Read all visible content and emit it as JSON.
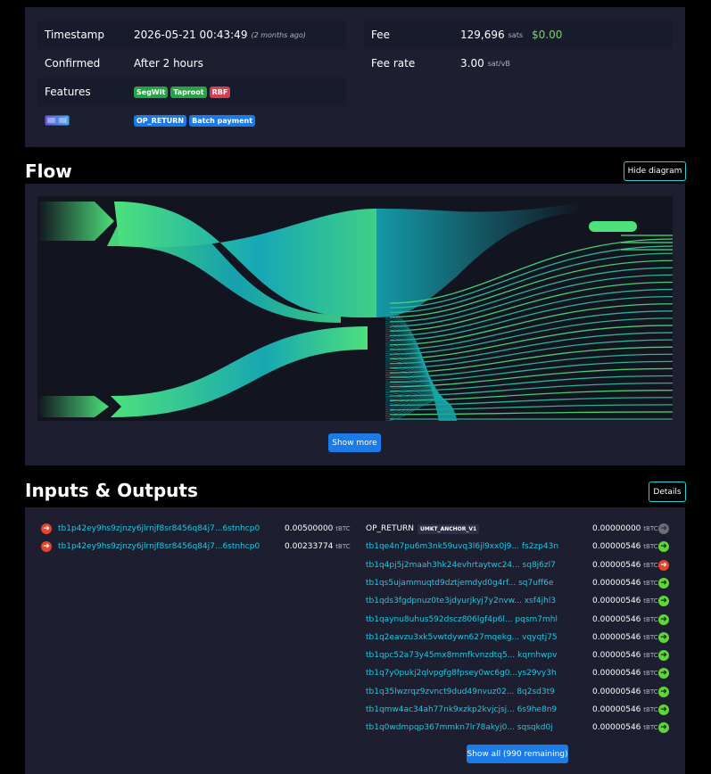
{
  "details": {
    "timestamp_label": "Timestamp",
    "timestamp_value": "2026-05-21 00:43:49",
    "timestamp_ago": "(2 months ago)",
    "confirmed_label": "Confirmed",
    "confirmed_value": "After 2 hours",
    "features_label": "Features",
    "features": [
      "SegWit",
      "Taproot",
      "RBF"
    ],
    "features_row2": [
      "OP_RETURN",
      "Batch payment"
    ],
    "fee_label": "Fee",
    "fee_value": "129,696",
    "fee_unit": "sats",
    "fee_fiat": "$0.00",
    "feerate_label": "Fee rate",
    "feerate_value": "3.00",
    "feerate_unit": "sat/vB"
  },
  "flow": {
    "title": "Flow",
    "hide_button": "Hide diagram",
    "show_more_button": "Show more"
  },
  "io": {
    "title": "Inputs & Outputs",
    "details_button": "Details",
    "inputs": [
      {
        "address": "tb1p42ey9hs9zjnzy6jlrnjf8sr8456q84j7...6stnhcp0",
        "amount": "0.00500000",
        "unit": "tBTC"
      },
      {
        "address": "tb1p42ey9hs9zjnzy6jlrnjf8sr8456q84j7...6stnhcp0",
        "amount": "0.00233774",
        "unit": "tBTC"
      }
    ],
    "outputs": [
      {
        "address": "OP_RETURN",
        "chip": "UMKT_ANCHOR_V1",
        "amount": "0.00000000",
        "unit": "tBTC",
        "status": "gray"
      },
      {
        "address": "tb1qe4n7pu6m3nk59uvq3l6jl9xx0j9...  fs2zp43n",
        "amount": "0.00000546",
        "unit": "tBTC",
        "status": "green"
      },
      {
        "address": "tb1q4pj5j2maah3hk24evhrtaytwc24...  sq8j6zl7",
        "amount": "0.00000546",
        "unit": "tBTC",
        "status": "red"
      },
      {
        "address": "tb1qs5ujammuqtd9dztjemdyd0g4rf...  sq7uff6e",
        "amount": "0.00000546",
        "unit": "tBTC",
        "status": "green"
      },
      {
        "address": "tb1qds3fgdpnuz0te3jdyurjkyj7y2nvw...  xsf4jhl3",
        "amount": "0.00000546",
        "unit": "tBTC",
        "status": "green"
      },
      {
        "address": "tb1qaynu8uhus592dscz806lgf4p6l...  pqsm7mhl",
        "amount": "0.00000546",
        "unit": "tBTC",
        "status": "green"
      },
      {
        "address": "tb1q2eavzu3xk5vwtdywn627mqekg...  vqyqtj75",
        "amount": "0.00000546",
        "unit": "tBTC",
        "status": "green"
      },
      {
        "address": "tb1qpc52a73y45mx8mmfkvnzdtq5...  kqrnhwpv",
        "amount": "0.00000546",
        "unit": "tBTC",
        "status": "green"
      },
      {
        "address": "tb1q7y0pukj2qlvpgfg8fpsey0wc6g0...ys29vy3h",
        "amount": "0.00000546",
        "unit": "tBTC",
        "status": "green"
      },
      {
        "address": "tb1q35lwzrqz9zvnct9dud49nvuz02...  8q2sd3t9",
        "amount": "0.00000546",
        "unit": "tBTC",
        "status": "green"
      },
      {
        "address": "tb1qmw4ac34ah77nk9xzkp2kvjcjsj...  6s9he8n9",
        "amount": "0.00000546",
        "unit": "tBTC",
        "status": "green"
      },
      {
        "address": "tb1q0wdmpqp367mmkn7lr78akyj0...  sqsqkd0j",
        "amount": "0.00000546",
        "unit": "tBTC",
        "status": "green"
      }
    ],
    "show_all_button": "Show all (990 remaining)"
  },
  "colors": {
    "accent": "#22d2d8",
    "flow_green": "#4de07b",
    "flow_teal": "#15a8b5",
    "button_blue": "#1b7be7"
  }
}
